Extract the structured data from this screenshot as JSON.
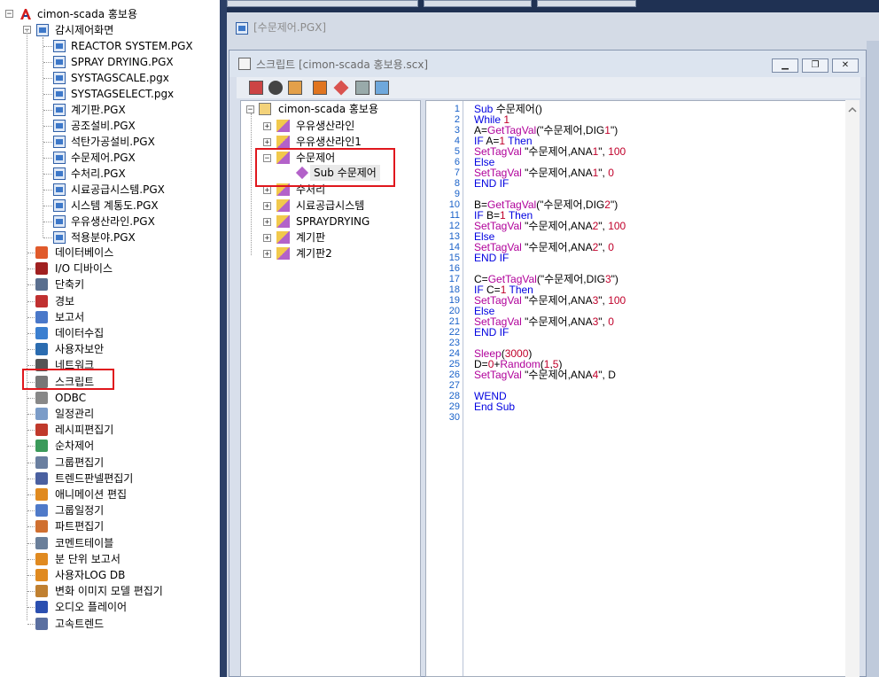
{
  "project_tree": {
    "root": "cimon-scada 홍보용",
    "monitoring": {
      "label": "감시제어화면",
      "pages": [
        "REACTOR SYSTEM.PGX",
        "SPRAY DRYING.PGX",
        "SYSTAGSCALE.pgx",
        "SYSTAGSELECT.pgx",
        "계기판.PGX",
        "공조설비.PGX",
        "석탄가공설비.PGX",
        "수문제어.PGX",
        "수처리.PGX",
        "시료공급시스템.PGX",
        "시스템 계통도.PGX",
        "우유생산라인.PGX",
        "적용분야.PGX"
      ]
    },
    "items": [
      "데이터베이스",
      "I/O 디바이스",
      "단축키",
      "경보",
      "보고서",
      "데이터수집",
      "사용자보안",
      "네트워크",
      "스크립트",
      "ODBC",
      "일정관리",
      "레시피편집기",
      "순차제어",
      "그룹편집기",
      "트렌드판넬편집기",
      "애니메이션 편집",
      "그룹일정기",
      "파트편집기",
      "코멘트테이블",
      "분 단위 보고서",
      "사용자LOG DB",
      "변화 이미지 모델 편집기",
      "오디오 플레이어",
      "고속트렌드"
    ]
  },
  "background_window": {
    "title": "[수문제어.PGX]"
  },
  "script_window": {
    "title": "스크립트 [cimon-scada 홍보용.scx]",
    "tree": {
      "root": "cimon-scada 홍보용",
      "nodes": [
        "우유생산라인",
        "우유생산라인1",
        "수문제어",
        "수처리",
        "시료공급시스템",
        "SPRAYDRYING",
        "계기판",
        "계기판2"
      ],
      "selected_sub": "Sub  수문제어"
    },
    "code_lines": [
      "Sub 수문제어()",
      "While 1",
      "A=GetTagVal(\"수문제어,DIG1\")",
      "IF A=1 Then",
      "SetTagVal \"수문제어,ANA1\", 100",
      "Else",
      "SetTagVal \"수문제어,ANA1\", 0",
      "END IF",
      "",
      "B=GetTagVal(\"수문제어,DIG2\")",
      "IF B=1 Then",
      "SetTagVal \"수문제어,ANA2\", 100",
      "Else",
      "SetTagVal \"수문제어,ANA2\", 0",
      "END IF",
      "",
      "C=GetTagVal(\"수문제어,DIG3\")",
      "IF C=1 Then",
      "SetTagVal \"수문제어,ANA3\", 100",
      "Else",
      "SetTagVal \"수문제어,ANA3\", 0",
      "END IF",
      "",
      "Sleep(3000)",
      "D=0+Random(1,5)",
      "SetTagVal \"수문제어,ANA4\", D",
      "",
      "WEND",
      "End Sub",
      ""
    ]
  },
  "colors": {
    "highlight_box": "#e0171d",
    "line_numbers": "#1a62c9",
    "keyword": "#0000e0",
    "function": "#b0009a"
  }
}
